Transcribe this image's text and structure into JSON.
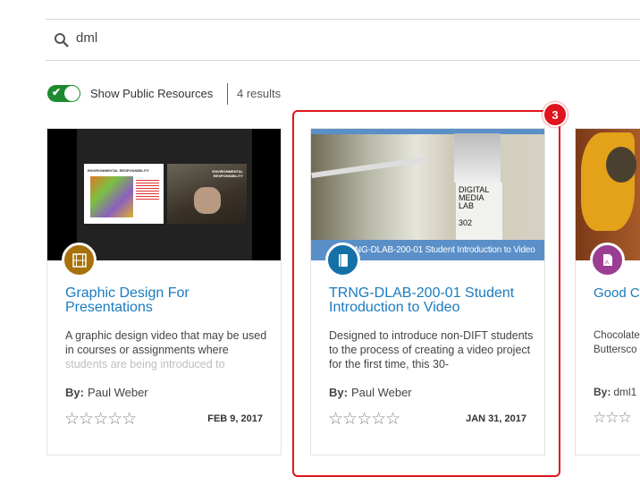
{
  "search": {
    "value": "dml",
    "icon": "search-icon"
  },
  "filter": {
    "toggle_label": "Show Public Resources",
    "toggle_on": true,
    "results": "4 results",
    "accent": "#1e8a2e"
  },
  "cards": [
    {
      "title_lines": [
        "Graphic Design For",
        "Presentations"
      ],
      "description": "A graphic design video that may be used in courses or assignments where students are being introduced to",
      "by_label": "By:",
      "author": "Paul Weber",
      "date": "FEB 9, 2017",
      "rating": 0,
      "type_icon": "film-icon",
      "icon_color": "#a8720a",
      "thumb_texts": [
        "ENVIRONMENTAL RESPONSIBILITY",
        "ENVIRONMENTAL RESPONSIBILITY"
      ]
    },
    {
      "title_lines": [
        "TRNG-DLAB-200-01 Student",
        "Introduction to Video"
      ],
      "description": "Designed to introduce non-DIFT students to the process of creating a video project for the first time, this 30-",
      "by_label": "By:",
      "author": "Paul Weber",
      "date": "JAN 31, 2017",
      "rating": 0,
      "type_icon": "book-icon",
      "icon_color": "#1570a6",
      "thumb_caption": "TRNG-DLAB-200-01 Student Introduction to Video",
      "thumb_sign": [
        "DIGITAL",
        "MEDIA",
        "LAB",
        "302"
      ]
    },
    {
      "title_lines": [
        "Good C"
      ],
      "description": "Chocolate Buttersco",
      "by_label": "By:",
      "author": "dml1",
      "rating": 0,
      "type_icon": "document-icon",
      "icon_color": "#9c3d94"
    }
  ],
  "highlight": {
    "badge": "3",
    "color": "#e0141e"
  }
}
